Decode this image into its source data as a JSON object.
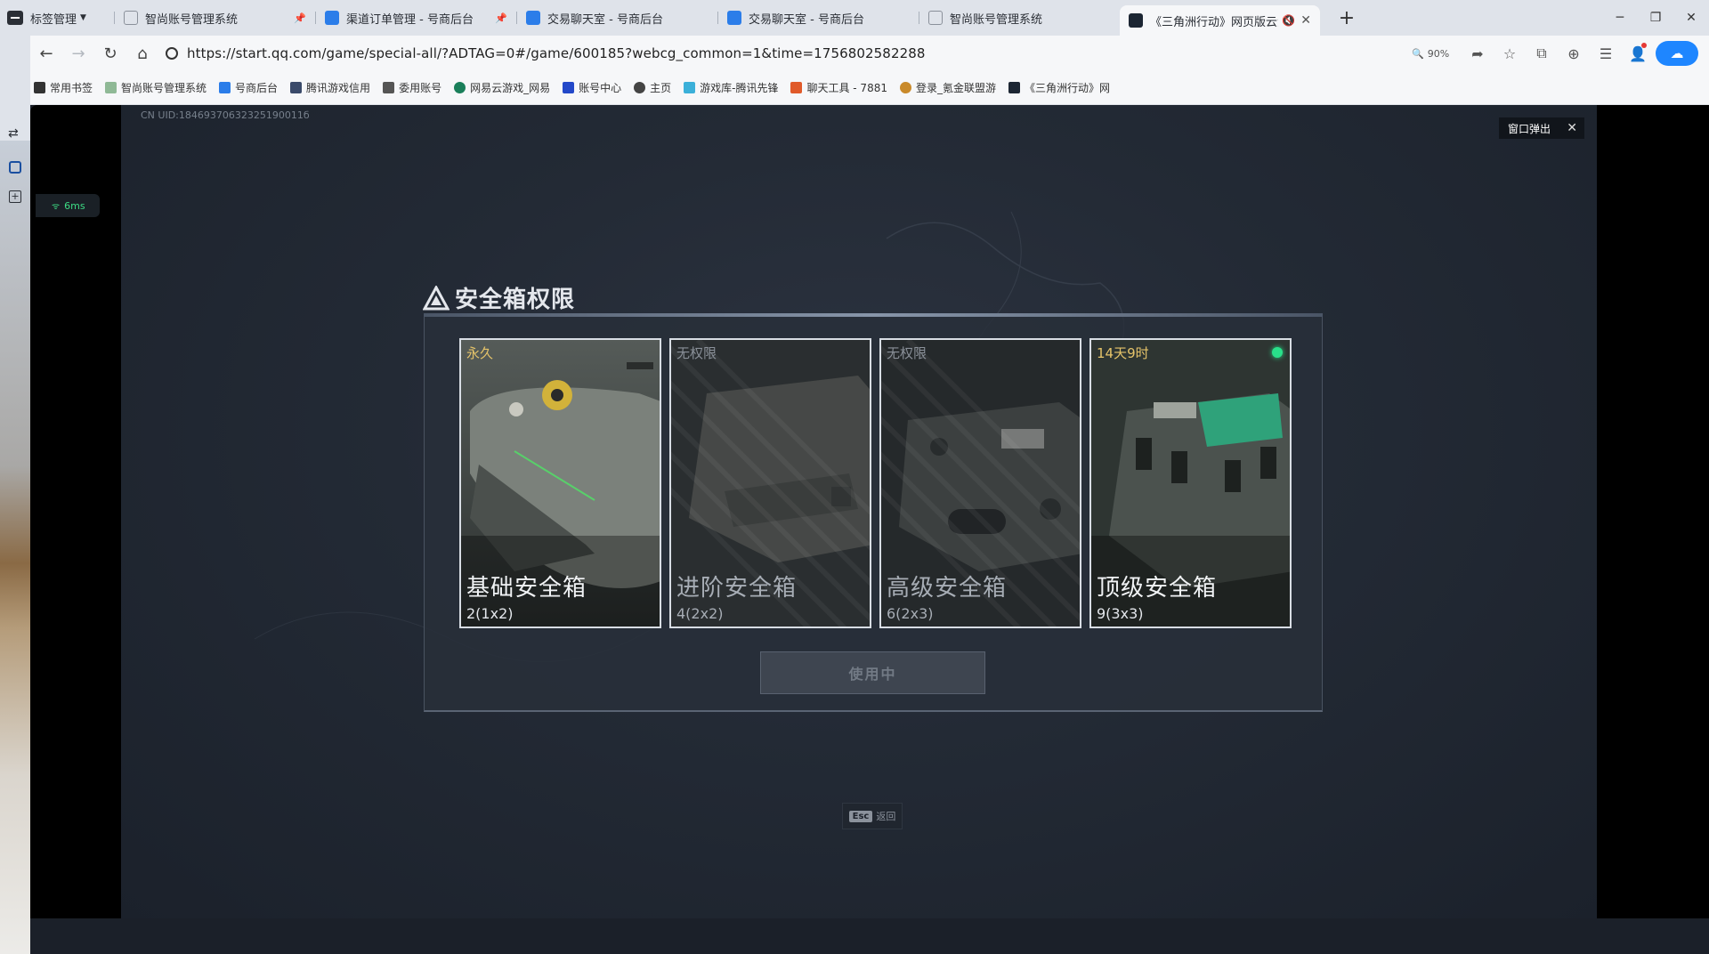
{
  "browser": {
    "tab_menu_label": "标签管理",
    "tabs": [
      {
        "title": "智尚账号管理系统",
        "pinned": true
      },
      {
        "title": "渠道订单管理 - 号商后台",
        "pinned": true
      },
      {
        "title": "交易聊天室 - 号商后台",
        "pinned": false
      },
      {
        "title": "交易聊天室 - 号商后台",
        "pinned": false
      },
      {
        "title": "智尚账号管理系统",
        "pinned": false
      },
      {
        "title": "《三角洲行动》网页版云游",
        "active": true
      }
    ],
    "url": "https://start.qq.com/game/special-all/?ADTAG=0#/game/600185?webcg_common=1&time=1756802582288",
    "zoom": "90%",
    "bookmarks": [
      "常用书签",
      "智尚账号管理系统",
      "号商后台",
      "腾讯游戏信用",
      "委用账号",
      "网易云游戏_网易",
      "账号中心",
      "主页",
      "游戏库-腾讯先锋",
      "聊天工具 - 7881",
      "登录_氪金联盟游",
      "《三角洲行动》网"
    ],
    "accent_color": "#1e86ff"
  },
  "game": {
    "uid": "CN UID:18469370632325190011б",
    "popout_label": "窗口弹出",
    "ping": "6ms",
    "panel_title": "安全箱权限",
    "cards": [
      {
        "tag": "永久",
        "name": "基础安全箱",
        "size": "2(1x2)",
        "selected": true,
        "available": true
      },
      {
        "tag": "无权限",
        "name": "进阶安全箱",
        "size": "4(2x2)",
        "selected": false,
        "available": false
      },
      {
        "tag": "无权限",
        "name": "高级安全箱",
        "size": "6(2x3)",
        "selected": false,
        "available": false
      },
      {
        "tag": "14天9时",
        "name": "顶级安全箱",
        "size": "9(3x3)",
        "selected": false,
        "available": true,
        "active": true
      }
    ],
    "use_button_label": "使用中",
    "esc_key": "Esc",
    "esc_label": "返回",
    "colors": {
      "tag_gold": "#e6c46a",
      "active_green": "#29e08a"
    }
  }
}
